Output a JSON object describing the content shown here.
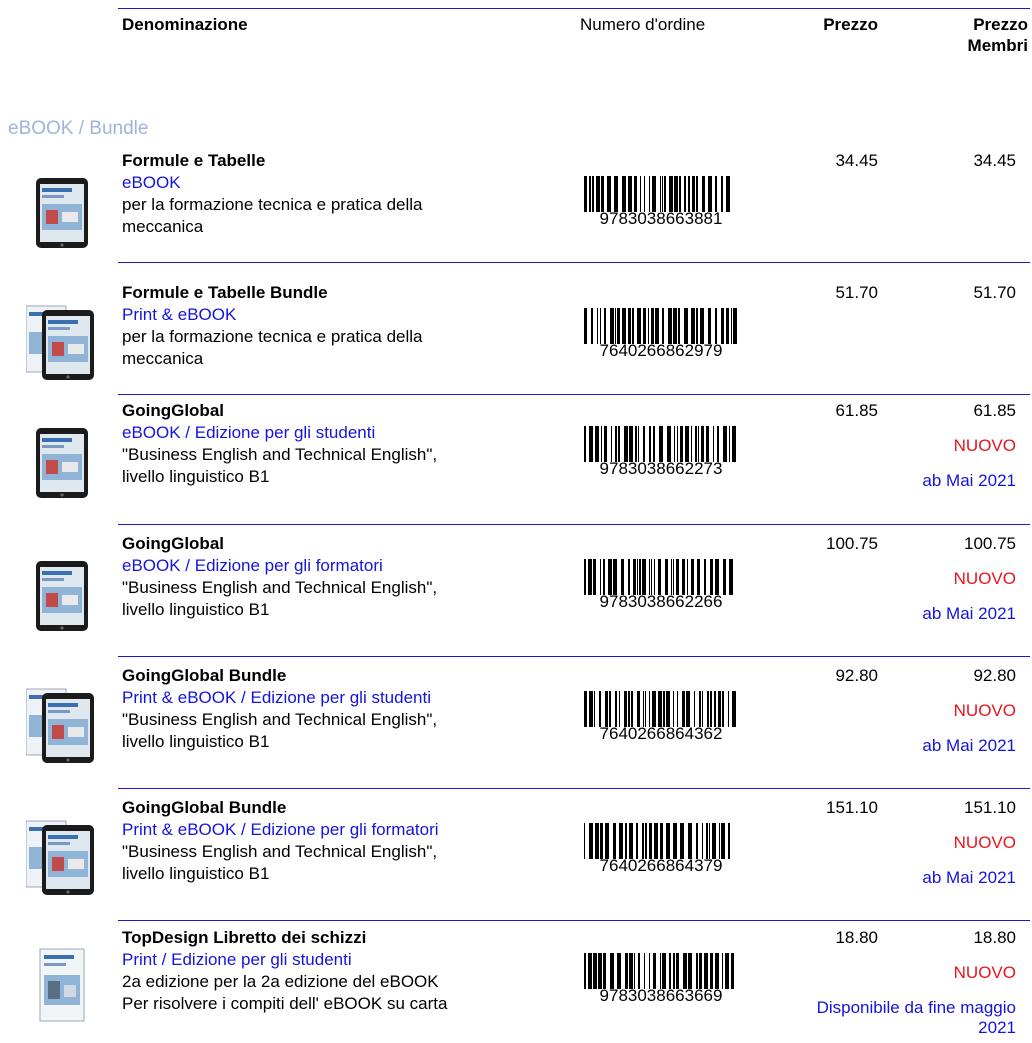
{
  "header": {
    "name": "Denominazione",
    "order_number": "Numero d'ordine",
    "price": "Prezzo",
    "member_price_1": "Prezzo",
    "member_price_2": "Membri"
  },
  "section_title": "eBOOK / Bundle",
  "colors": {
    "rule": "#1a1acc",
    "blue_text": "#1414dc",
    "new_badge": "#e8141e",
    "section": "#9fb4dc"
  },
  "products": [
    {
      "title": "Formule e Tabelle",
      "variant": "eBOOK",
      "desc": [
        "per la formazione tecnica e pratica della",
        "meccanica"
      ],
      "code": "9783038663881",
      "price": "34.45",
      "member_price": "34.45",
      "badge": "",
      "availability": [],
      "thumb": "tablet"
    },
    {
      "title": "Formule e Tabelle Bundle",
      "variant": "Print & eBOOK",
      "desc": [
        "per la formazione tecnica e pratica della",
        "meccanica"
      ],
      "code": "7640266862979",
      "price": "51.70",
      "member_price": "51.70",
      "badge": "",
      "availability": [],
      "thumb": "bundle"
    },
    {
      "title": "GoingGlobal",
      "variant": "eBOOK / Edizione per gli studenti",
      "desc": [
        "\"Business English and Technical English\",",
        "livello linguistico B1"
      ],
      "code": "9783038662273",
      "price": "61.85",
      "member_price": "61.85",
      "badge": "NUOVO",
      "availability": [
        "ab Mai 2021"
      ],
      "thumb": "tablet"
    },
    {
      "title": "GoingGlobal",
      "variant": "eBOOK / Edizione per gli formatori",
      "desc": [
        "\"Business English and Technical English\",",
        "livello linguistico B1"
      ],
      "code": "9783038662266",
      "price": "100.75",
      "member_price": "100.75",
      "badge": "NUOVO",
      "availability": [
        "ab Mai 2021"
      ],
      "thumb": "tablet"
    },
    {
      "title": "GoingGlobal Bundle",
      "variant": "Print & eBOOK / Edizione per gli studenti",
      "desc": [
        "\"Business English and Technical English\",",
        "livello linguistico B1"
      ],
      "code": "7640266864362",
      "price": "92.80",
      "member_price": "92.80",
      "badge": "NUOVO",
      "availability": [
        "ab Mai 2021"
      ],
      "thumb": "bundle"
    },
    {
      "title": "GoingGlobal Bundle",
      "variant": "Print & eBOOK / Edizione per gli formatori",
      "desc": [
        "\"Business English and Technical English\",",
        "livello linguistico B1"
      ],
      "code": "7640266864379",
      "price": "151.10",
      "member_price": "151.10",
      "badge": "NUOVO",
      "availability": [
        "ab Mai 2021"
      ],
      "thumb": "bundle"
    },
    {
      "title": "TopDesign Libretto dei schizzi",
      "variant": "Print / Edizione per gli studenti",
      "desc": [
        "2a edizione per la 2a edizione del eBOOK",
        "Per risolvere i compiti dell' eBOOK su carta"
      ],
      "code": "9783038663669",
      "price": "18.80",
      "member_price": "18.80",
      "badge": "NUOVO",
      "availability": [
        "Disponibile da fine maggio",
        "2021"
      ],
      "thumb": "book"
    }
  ]
}
